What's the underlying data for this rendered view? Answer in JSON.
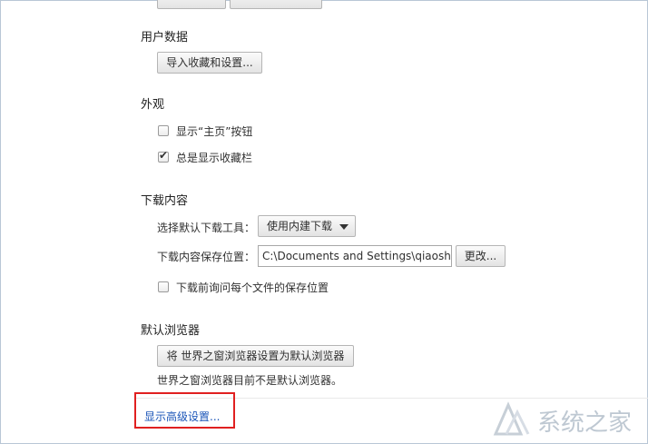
{
  "top_buttons": [
    "",
    ""
  ],
  "user_data": {
    "title": "用户数据",
    "import_button": "导入收藏和设置..."
  },
  "appearance": {
    "title": "外观",
    "show_home_button": {
      "label": "显示“主页”按钮",
      "checked": false
    },
    "show_bookmarks_bar": {
      "label": "总是显示收藏栏",
      "checked": true
    }
  },
  "downloads": {
    "title": "下载内容",
    "tool_label": "选择默认下载工具：",
    "tool_value": "使用内建下载",
    "location_label": "下载内容保存位置：",
    "location_value": "C:\\Documents and Settings\\qiaoshiyu",
    "change_button": "更改...",
    "ask_location": {
      "label": "下载前询问每个文件的保存位置",
      "checked": false
    }
  },
  "default_browser": {
    "title": "默认浏览器",
    "set_button": "将 世界之窗浏览器设置为默认浏览器",
    "status_text": "世界之窗浏览器目前不是默认浏览器。"
  },
  "advanced_link": "显示高级设置...",
  "watermark": "系统之家",
  "colors": {
    "link": "#1b55b8",
    "highlight_box": "#e02020"
  }
}
